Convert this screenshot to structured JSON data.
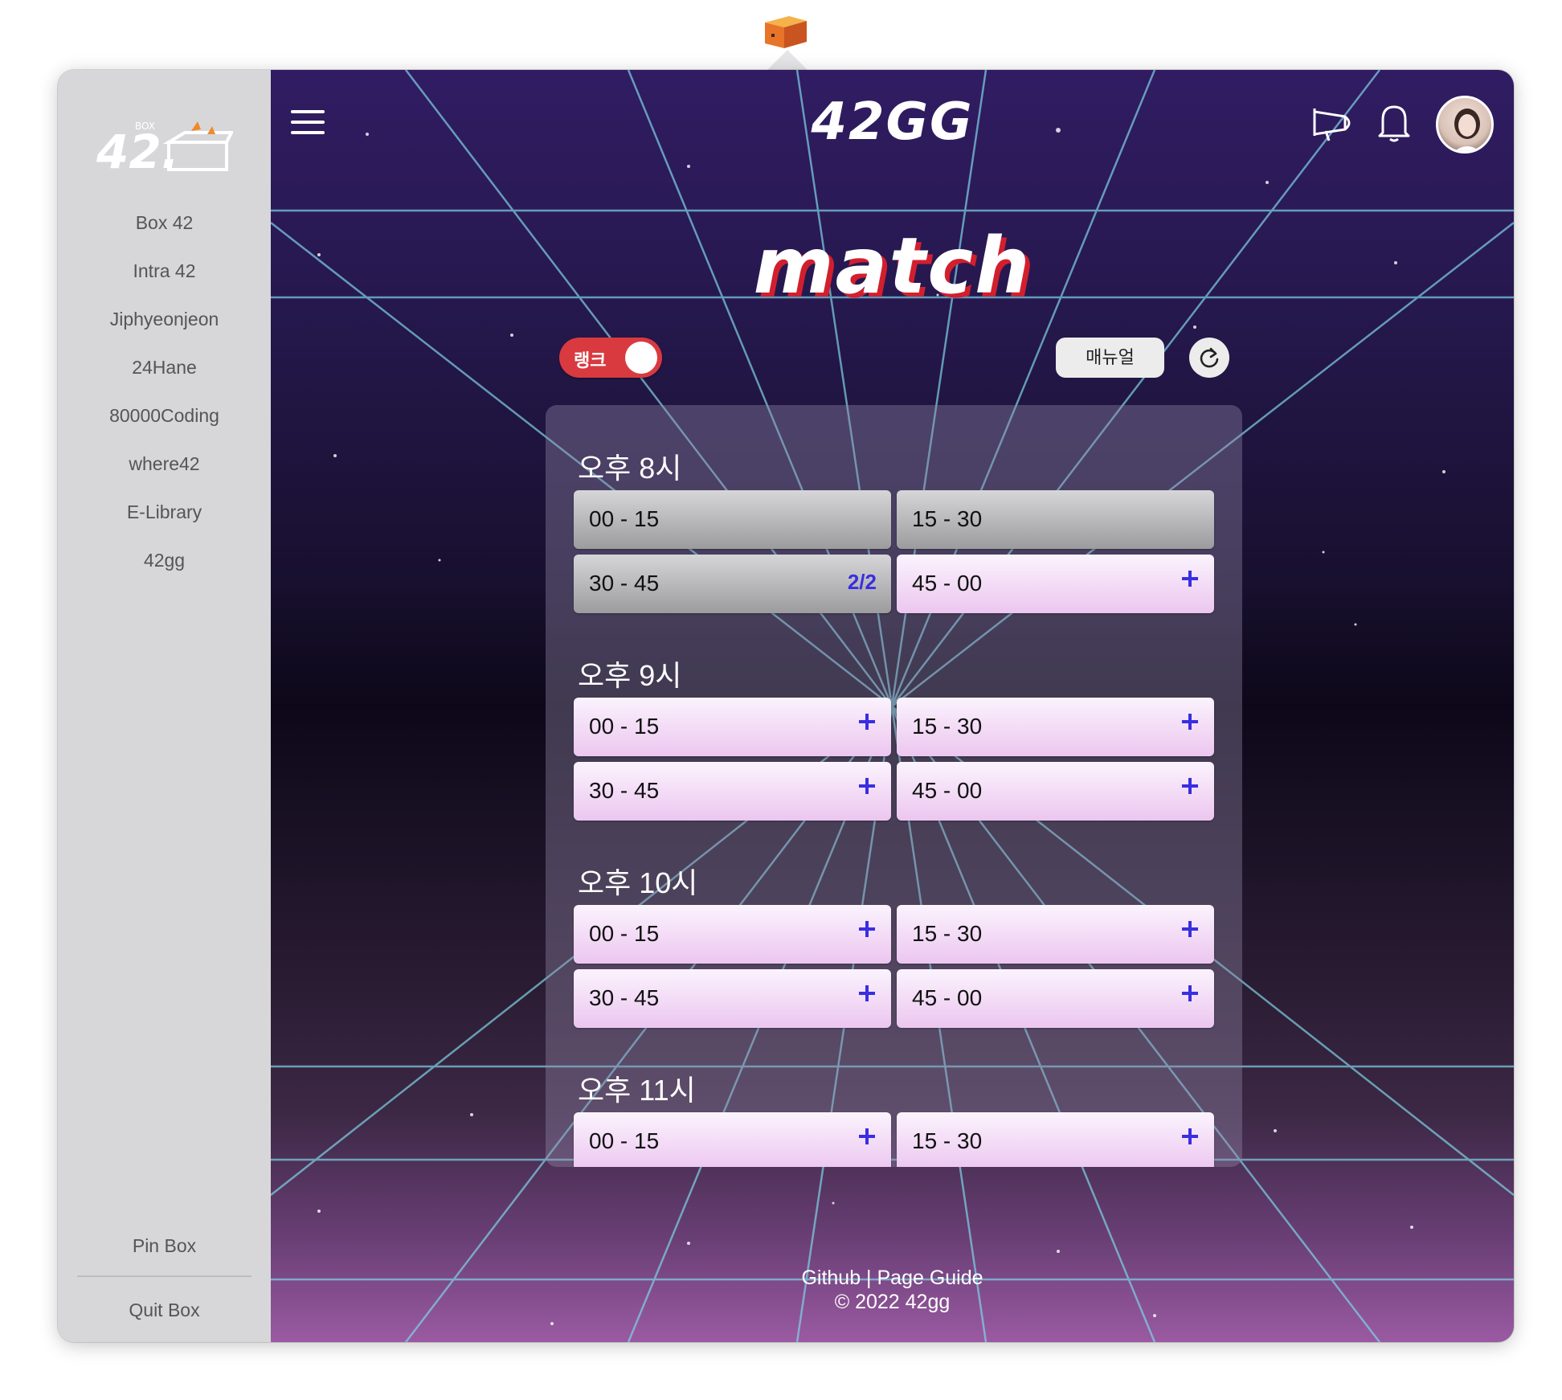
{
  "sidebar": {
    "logo_alt": "42 BOX",
    "items": [
      {
        "label": "Box 42"
      },
      {
        "label": "Intra 42"
      },
      {
        "label": "Jiphyeonjeon"
      },
      {
        "label": "24Hane"
      },
      {
        "label": "80000Coding"
      },
      {
        "label": "where42"
      },
      {
        "label": "E-Library"
      },
      {
        "label": "42gg"
      }
    ],
    "pin_label": "Pin Box",
    "quit_label": "Quit Box"
  },
  "header": {
    "brand": "42GG",
    "icons": [
      "hamburger-icon",
      "megaphone-icon",
      "bell-icon",
      "avatar"
    ]
  },
  "page": {
    "title": "match",
    "mode_toggle": {
      "label": "랭크",
      "on": true
    },
    "manual_label": "매뉴얼"
  },
  "slots": [
    {
      "hour": "오후 8시",
      "slots": [
        {
          "time": "00 - 15",
          "status": "closed",
          "count": ""
        },
        {
          "time": "15 - 30",
          "status": "closed",
          "count": ""
        },
        {
          "time": "30 - 45",
          "status": "closed",
          "count": "2/2"
        },
        {
          "time": "45 - 00",
          "status": "open",
          "count": ""
        }
      ]
    },
    {
      "hour": "오후 9시",
      "slots": [
        {
          "time": "00 - 15",
          "status": "open",
          "count": ""
        },
        {
          "time": "15 - 30",
          "status": "open",
          "count": ""
        },
        {
          "time": "30 - 45",
          "status": "open",
          "count": ""
        },
        {
          "time": "45 - 00",
          "status": "open",
          "count": ""
        }
      ]
    },
    {
      "hour": "오후 10시",
      "slots": [
        {
          "time": "00 - 15",
          "status": "open",
          "count": ""
        },
        {
          "time": "15 - 30",
          "status": "open",
          "count": ""
        },
        {
          "time": "30 - 45",
          "status": "open",
          "count": ""
        },
        {
          "time": "45 - 00",
          "status": "open",
          "count": ""
        }
      ]
    },
    {
      "hour": "오후 11시",
      "slots": [
        {
          "time": "00 - 15",
          "status": "open",
          "count": ""
        },
        {
          "time": "15 - 30",
          "status": "open",
          "count": ""
        }
      ]
    }
  ],
  "footer": {
    "github": "Github",
    "separator": " | ",
    "guide": "Page Guide",
    "copyright": "© 2022 42gg"
  },
  "colors": {
    "accent_plus": "#3a2ee0",
    "toggle_red": "#d83a3f",
    "grid_line": "#7fd3e6",
    "title_shadow": "#d21f2e"
  }
}
